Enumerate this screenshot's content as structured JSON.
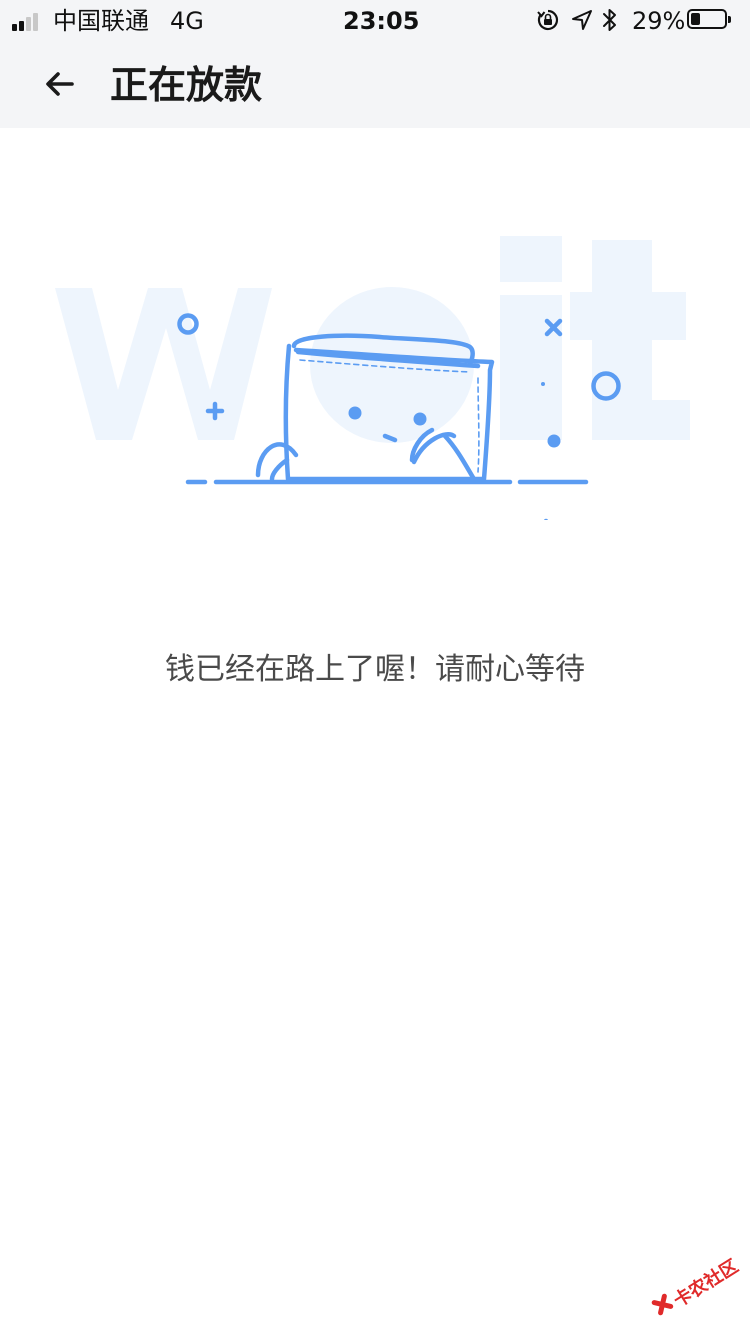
{
  "status_bar": {
    "carrier": "中国联通",
    "network": "4G",
    "time": "23:05",
    "battery_text": "29%",
    "battery_level": 0.29,
    "signal_bars": 2,
    "icons": [
      "signal-icon",
      "orientation-lock-icon",
      "location-arrow-icon",
      "bluetooth-icon",
      "battery-icon"
    ]
  },
  "header": {
    "title": "正在放款",
    "back_icon": "back-arrow-icon"
  },
  "illustration": {
    "background_word": "wait",
    "subject": "wallet-character-icon"
  },
  "main": {
    "message": "钱已经在路上了喔！请耐心等待"
  },
  "watermark": {
    "text": "卡农社区"
  },
  "colors": {
    "header_bg": "#f4f5f7",
    "accent_blue": "#5b9cf2",
    "faint_blue": "#eef5fd",
    "text_dark": "#1a1a1a",
    "text_body": "#4a4a4a",
    "watermark_red": "#e02a2a"
  }
}
